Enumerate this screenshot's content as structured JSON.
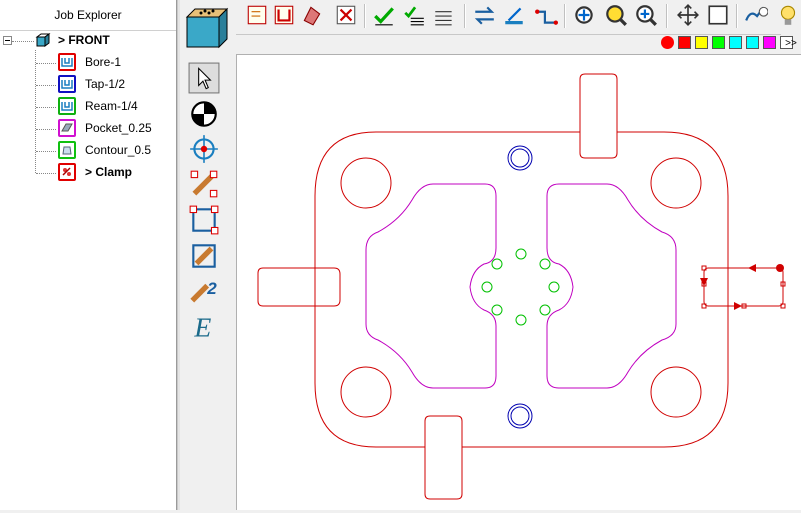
{
  "job_explorer": {
    "title": "Job Explorer",
    "root": {
      "label": "> FRONT"
    },
    "items": [
      {
        "label": "Bore-1",
        "icon": "bore-icon",
        "color": "#e00000"
      },
      {
        "label": "Tap-1/2",
        "icon": "tap-icon",
        "color": "#1010c0"
      },
      {
        "label": "Ream-1/4",
        "icon": "ream-icon",
        "color": "#10b010"
      },
      {
        "label": "Pocket_0.25",
        "icon": "pocket-icon",
        "color": "#d010d0"
      },
      {
        "label": "Contour_0.5",
        "icon": "contour-icon",
        "color": "#10c010"
      },
      {
        "label": "> Clamp",
        "icon": "clamp-icon",
        "color": "#e00000",
        "bold": true
      }
    ]
  },
  "toolbar": {
    "overflow_label": ">>",
    "buttons": [
      "view-cube-icon",
      "face-mill-icon",
      "contour-tool-icon",
      "drill-tool-icon",
      "delete-op-icon",
      "checkmark-icon",
      "multi-check-icon",
      "stack-icon",
      "swap-icon",
      "edit-icon",
      "step-icon",
      "zoom-fit-icon",
      "zoom-window-icon",
      "zoom-in-icon",
      "move-icon",
      "select-box-icon",
      "hook-icon",
      "lightbulb-icon"
    ],
    "colors": [
      "#ff0000",
      "#ff0000",
      "#ffff00",
      "#00ff00",
      "#00ffff",
      "#00ffff",
      "#ff00ff",
      "#ffffff"
    ]
  },
  "left_tools": [
    "select-arrow-icon",
    "origin-icon",
    "crosshair-icon",
    "chain-icon",
    "rect-chain-icon",
    "rotate-chain-icon",
    "chain-2-icon",
    "edit-e-icon"
  ],
  "colors": {
    "part_outline": "#d00000",
    "pocket": "#c000c0",
    "holes": "#00c000",
    "tap_holes": "#0000b0"
  }
}
